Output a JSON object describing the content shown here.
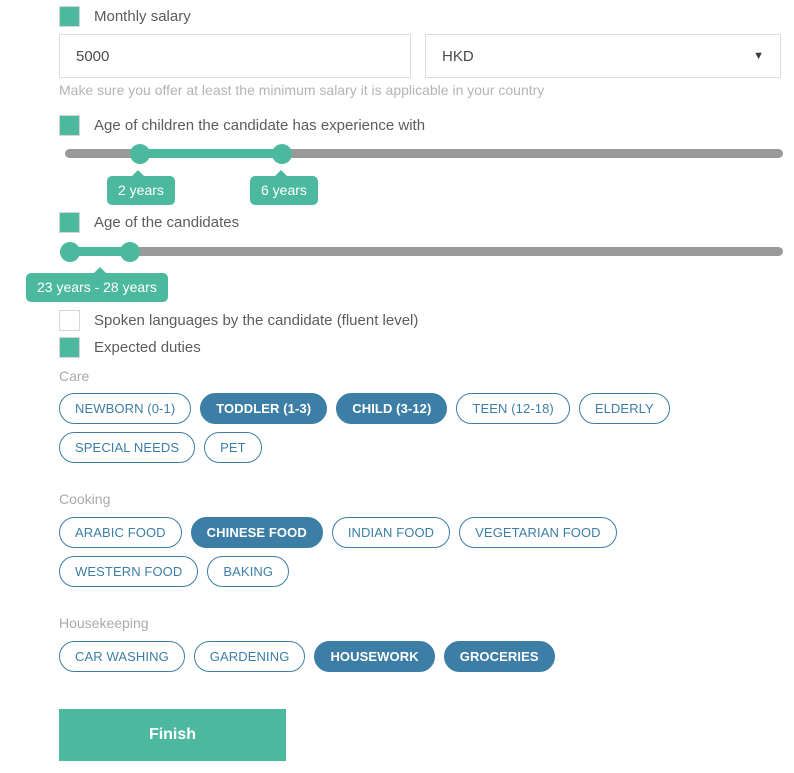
{
  "theme": {
    "teal": "#4cb99f",
    "pill_blue": "#3d7ea6",
    "track_gray": "#9a9a9a",
    "label_gray": "#5c5c5c",
    "muted_gray": "#aaaaaa",
    "border_gray": "#dcdcdc"
  },
  "salary": {
    "checkbox_checked": true,
    "label": "Monthly salary",
    "amount_value": "5000",
    "amount_placeholder": "Monthly salary",
    "currency_value": "HKD",
    "currency_caret": "chevron-down-icon",
    "hint": "Make sure you offer at least the minimum salary it is applicable in your country"
  },
  "children_age": {
    "checkbox_checked": true,
    "label": "Age of children the candidate has experience with",
    "min_bubble": "2 years",
    "max_bubble": "6 years",
    "min_value": 2,
    "max_value": 6
  },
  "candidate_age": {
    "checkbox_checked": true,
    "label": "Age of the candidates",
    "range_bubble": "23 years - 28 years",
    "min_value": 23,
    "max_value": 28
  },
  "spoken_languages": {
    "checkbox_checked": false,
    "label": "Spoken languages by the candidate (fluent level)"
  },
  "expected_duties": {
    "checkbox_checked": true,
    "label": "Expected duties",
    "groups": [
      {
        "name": "Care",
        "options": [
          {
            "label": "NEWBORN (0-1)",
            "selected": false
          },
          {
            "label": "TODDLER (1-3)",
            "selected": true
          },
          {
            "label": "CHILD (3-12)",
            "selected": true
          },
          {
            "label": "TEEN (12-18)",
            "selected": false
          },
          {
            "label": "ELDERLY",
            "selected": false
          },
          {
            "label": "SPECIAL NEEDS",
            "selected": false
          },
          {
            "label": "PET",
            "selected": false
          }
        ]
      },
      {
        "name": "Cooking",
        "options": [
          {
            "label": "ARABIC FOOD",
            "selected": false
          },
          {
            "label": "CHINESE FOOD",
            "selected": true
          },
          {
            "label": "INDIAN FOOD",
            "selected": false
          },
          {
            "label": "VEGETARIAN FOOD",
            "selected": false
          },
          {
            "label": "WESTERN FOOD",
            "selected": false
          },
          {
            "label": "BAKING",
            "selected": false
          }
        ]
      },
      {
        "name": "Housekeeping",
        "options": [
          {
            "label": "CAR WASHING",
            "selected": false
          },
          {
            "label": "GARDENING",
            "selected": false
          },
          {
            "label": "HOUSEWORK",
            "selected": true
          },
          {
            "label": "GROCERIES",
            "selected": true
          }
        ]
      }
    ]
  },
  "footer": {
    "finish_label": "Finish"
  }
}
